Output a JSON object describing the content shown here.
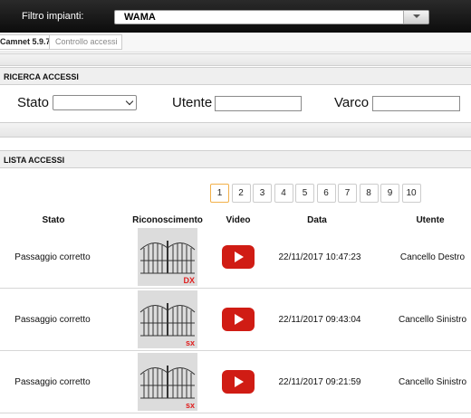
{
  "topbar": {
    "filter_label": "Filtro impianti:",
    "filter_value": "WAMA"
  },
  "breadcrumb": {
    "app": "Camnet 5.9.7",
    "page": "Controllo accessi"
  },
  "search": {
    "title": "RICERCA ACCESSI",
    "stato_label": "Stato",
    "utente_label": "Utente",
    "varco_label": "Varco"
  },
  "list": {
    "title": "LISTA ACCESSI",
    "pages": [
      "1",
      "2",
      "3",
      "4",
      "5",
      "6",
      "7",
      "8",
      "9",
      "10"
    ],
    "active_page": "1",
    "columns": {
      "stato": "Stato",
      "riconoscimento": "Riconoscimento",
      "video": "Video",
      "data": "Data",
      "utente": "Utente"
    },
    "rows": [
      {
        "stato": "Passaggio corretto",
        "side": "DX",
        "data": "22/11/2017 10:47:23",
        "utente": "Cancello Destro"
      },
      {
        "stato": "Passaggio corretto",
        "side": "sx",
        "data": "22/11/2017 09:43:04",
        "utente": "Cancello Sinistro"
      },
      {
        "stato": "Passaggio corretto",
        "side": "sx",
        "data": "22/11/2017 09:21:59",
        "utente": "Cancello Sinistro"
      }
    ]
  },
  "colors": {
    "accent_red": "#d01c14",
    "topbar": "#111111",
    "active_page_border": "#f2b04a"
  },
  "icons": {
    "play": "play-video-icon",
    "gate": "gate-icon",
    "dropdown": "chevron-down-icon"
  }
}
